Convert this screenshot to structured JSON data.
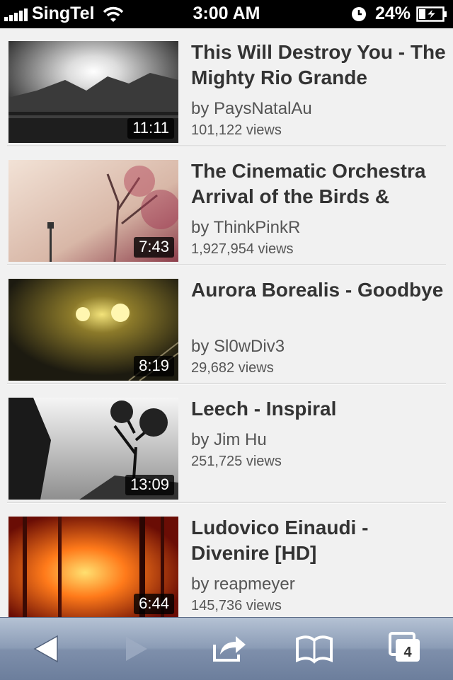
{
  "status_bar": {
    "carrier": "SingTel",
    "time": "3:00 AM",
    "battery_percent": "24%"
  },
  "videos": [
    {
      "title": "This Will Destroy You - The Mighty Rio Grande",
      "channel": "by PaysNatalAu",
      "views": "101,122 views",
      "duration": "11:11"
    },
    {
      "title": "The Cinematic Orchestra Arrival of the Birds &",
      "channel": "by ThinkPinkR",
      "views": "1,927,954 views",
      "duration": "7:43"
    },
    {
      "title": "Aurora Borealis - Goodbye",
      "channel": "by Sl0wDiv3",
      "views": "29,682 views",
      "duration": "8:19"
    },
    {
      "title": "Leech - Inspiral",
      "channel": "by Jim Hu",
      "views": "251,725 views",
      "duration": "13:09"
    },
    {
      "title": "Ludovico Einaudi - Divenire [HD]",
      "channel": "by reapmeyer",
      "views": "145,736 views",
      "duration": "6:44"
    }
  ],
  "toolbar": {
    "back_icon": "back-arrow-icon",
    "forward_icon": "forward-arrow-icon",
    "share_icon": "share-icon",
    "bookmarks_icon": "bookmarks-icon",
    "tabs_icon": "tabs-icon",
    "tabs_count": "4"
  }
}
